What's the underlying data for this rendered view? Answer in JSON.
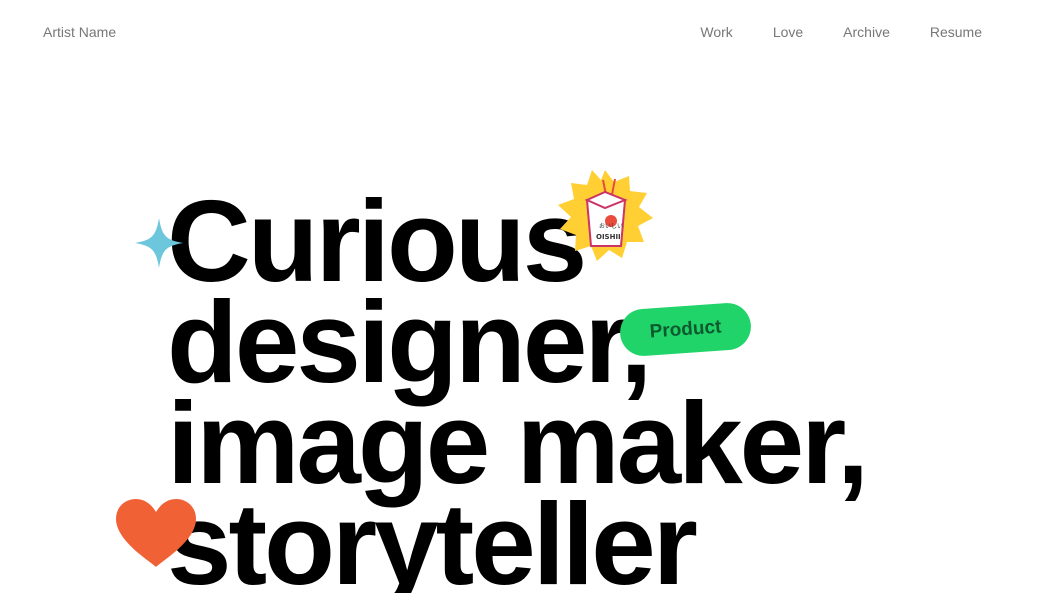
{
  "header": {
    "site_name": "Artist Name",
    "nav": [
      "Work",
      "Love",
      "Archive",
      "Resume"
    ]
  },
  "hero": {
    "lines": [
      "Curious",
      "designer,",
      "image maker,",
      "storyteller"
    ]
  },
  "stickers": {
    "tag_label": "Product",
    "takeout_text_top": "おいしい",
    "takeout_text_bottom": "OISHII"
  },
  "colors": {
    "sparkle": "#6cc7dd",
    "badge": "#ffcf33",
    "tag": "#20d46a",
    "tag_text": "#0c5a2e",
    "heart": "#f06236",
    "nav_text": "#777777"
  }
}
